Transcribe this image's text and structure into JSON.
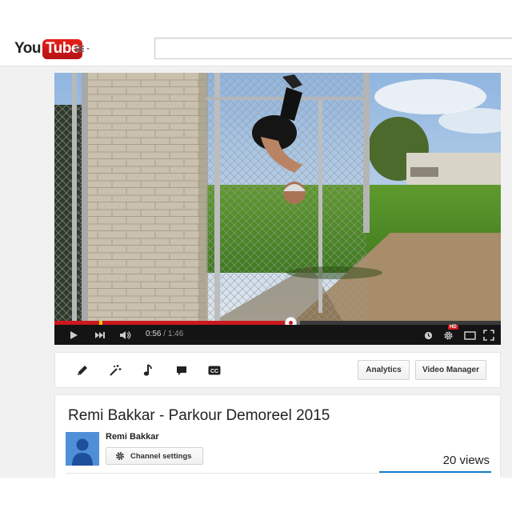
{
  "masthead": {
    "logo_you": "You",
    "logo_tube": "Tube",
    "guide_icon": "menu-icon",
    "search_value": ""
  },
  "player": {
    "current_time": "0:56",
    "separator": " / ",
    "duration": "1:46",
    "progress_fraction": 0.528,
    "buffer_fraction": 0.55,
    "hd_badge": "HD",
    "icons": [
      "play-icon",
      "next-icon",
      "volume-icon",
      "clock-icon",
      "gear-icon",
      "theater-icon",
      "fullscreen-icon"
    ],
    "accent_color": "#cc181e"
  },
  "actions": {
    "tools": [
      "pencil-icon",
      "magic-wand-icon",
      "music-note-icon",
      "annotation-icon",
      "cc-icon"
    ],
    "analytics_label": "Analytics",
    "video_manager_label": "Video Manager"
  },
  "video": {
    "title": "Remi Bakkar - Parkour Demoreel 2015",
    "channel_name": "Remi Bakkar",
    "channel_settings_label": "Channel settings",
    "views": "20 views",
    "link_color": "#167ac6"
  }
}
